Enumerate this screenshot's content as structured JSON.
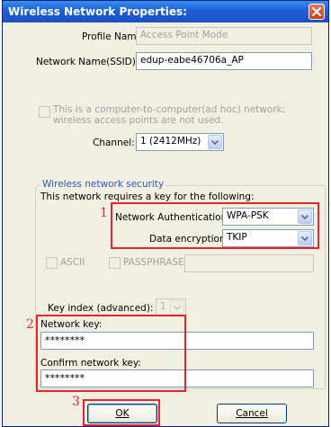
{
  "window": {
    "title": "Wireless Network Properties:"
  },
  "profile": {
    "label": "Profile Name:",
    "value": "Access Point Mode"
  },
  "ssid": {
    "label": "Network Name(SSID):",
    "value": "edup-eabe46706a_AP"
  },
  "adhoc": {
    "text": "This is a computer-to-computer(ad hoc) network; wireless access points are not used.",
    "checked": false
  },
  "channel": {
    "label": "Channel:",
    "value": "1  (2412MHz)"
  },
  "security": {
    "legend": "Wireless network security",
    "intro": "This network requires a key for the following:",
    "auth_label": "Network Authentication:",
    "auth_value": "WPA-PSK",
    "enc_label": "Data encryption:",
    "enc_value": "TKIP",
    "ascii_label": "ASCII",
    "passphrase_label": "PASSPHRASE",
    "key_index_label": "Key index (advanced):",
    "key_index_value": "1",
    "network_key_label": "Network key:",
    "network_key_value": "********",
    "confirm_key_label": "Confirm network key:",
    "confirm_key_value": "********"
  },
  "annotations": {
    "n1": "1",
    "n2": "2",
    "n3": "3",
    "color": "#e3262e"
  },
  "buttons": {
    "ok_label": "OK",
    "cancel_label": "Cancel"
  },
  "colors": {
    "titlebar": "#1f5fd6",
    "dialog_bg": "#f1efe2",
    "group_label": "#2c57c8"
  }
}
